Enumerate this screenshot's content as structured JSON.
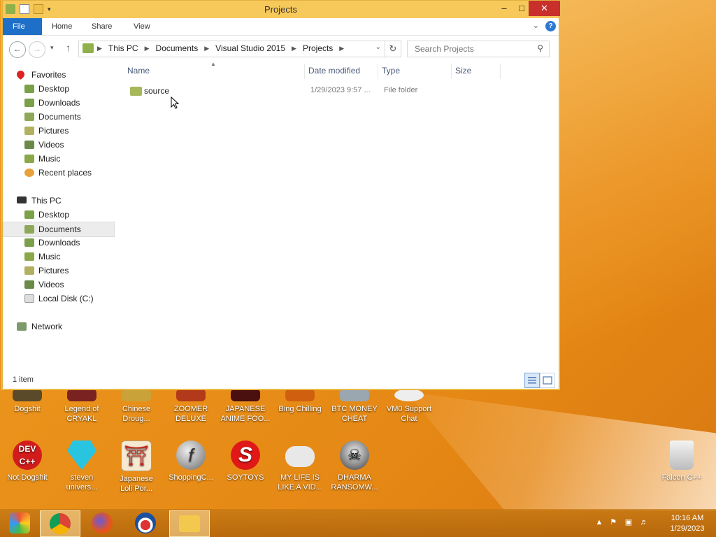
{
  "window": {
    "title": "Projects",
    "minimize": "–",
    "maximize": "□",
    "close": "✕"
  },
  "ribbon": {
    "file": "File",
    "tabs": [
      "Home",
      "Share",
      "View"
    ],
    "help": "?"
  },
  "address": {
    "crumbs": [
      "This PC",
      "Documents",
      "Visual Studio 2015",
      "Projects"
    ]
  },
  "search": {
    "placeholder": "Search Projects"
  },
  "nav": {
    "favorites_label": "Favorites",
    "favorites": [
      "Desktop",
      "Downloads",
      "Documents",
      "Pictures",
      "Videos",
      "Music",
      "Recent places"
    ],
    "thispc_label": "This PC",
    "thispc": [
      "Desktop",
      "Documents",
      "Downloads",
      "Music",
      "Pictures",
      "Videos",
      "Local Disk (C:)"
    ],
    "network_label": "Network",
    "selected": "Documents"
  },
  "columns": {
    "name": "Name",
    "date": "Date modified",
    "type": "Type",
    "size": "Size"
  },
  "files": [
    {
      "name": "source",
      "date": "1/29/2023 9:57 ...",
      "type": "File folder",
      "size": ""
    }
  ],
  "status": {
    "count": "1 item"
  },
  "desktop_icons": [
    {
      "label": "Dogshit",
      "icon": "dogshit-icon"
    },
    {
      "label": "Legend of\nCRYAKL",
      "icon": "cryakl-icon"
    },
    {
      "label": "Chinese\nDroug...",
      "icon": "chinese-drought-icon"
    },
    {
      "label": "ZOOMER\nDELUXE",
      "icon": "zoomer-icon"
    },
    {
      "label": "JAPANESE\nANIME FOO...",
      "icon": "anime-icon"
    },
    {
      "label": "Bing Chilling",
      "icon": "bing-chilling-icon"
    },
    {
      "label": "BTC MONEY\nCHEAT",
      "icon": "btc-icon"
    },
    {
      "label": "VM0 Support\nChat",
      "icon": "support-chat-icon"
    },
    {
      "label": "Not Dogshit",
      "icon": "devcpp-icon"
    },
    {
      "label": "steven\nunivers...",
      "icon": "diamond-icon"
    },
    {
      "label": "Japanese\nLoli Por...",
      "icon": "torii-icon"
    },
    {
      "label": "ShoppingC...",
      "icon": "flash-icon"
    },
    {
      "label": "SOYTOYS",
      "icon": "soytoys-icon"
    },
    {
      "label": "MY LIFE IS\nLIKE A VID...",
      "icon": "gamepad-icon"
    },
    {
      "label": "DHARMA\nRANSOMW...",
      "icon": "skull-icon"
    },
    {
      "label": "Falcon C++",
      "icon": "recycle-bin-icon"
    }
  ],
  "clock": {
    "time": "10:16 AM",
    "date": "1/29/2023"
  }
}
